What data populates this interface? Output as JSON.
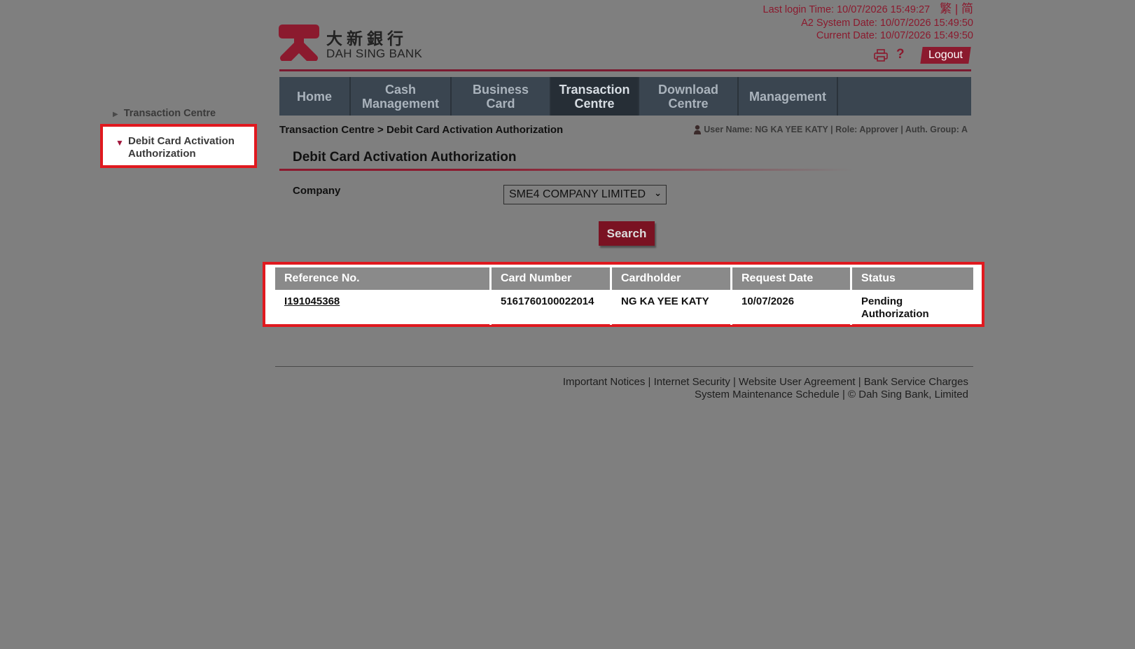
{
  "header": {
    "last_login": "Last login Time: 10/07/2026 15:49:27",
    "lang_links": "繁 | 简",
    "system_date": "A2 System Date: 10/07/2026 15:49:50",
    "current_date": "Current Date: 10/07/2026 15:49:50",
    "help_label": "?",
    "logout_label": "Logout",
    "brand_color": "#8b1a2e"
  },
  "logo": {
    "chinese_name": "大新銀行",
    "english_name": "DAH SING BANK"
  },
  "nav": {
    "items": [
      {
        "label": "Home",
        "active": false
      },
      {
        "label": "Cash Management",
        "active": false
      },
      {
        "label": "Business Card",
        "active": false
      },
      {
        "label": "Transaction Centre",
        "active": true
      },
      {
        "label": "Download Centre",
        "active": false
      },
      {
        "label": "Management",
        "active": false
      }
    ]
  },
  "sidebar": {
    "parent_label": "Transaction Centre",
    "child_label": "Debit Card Activation Authorization"
  },
  "breadcrumb": "Transaction Centre > Debit Card Activation Authorization",
  "user_info": "User Name: NG KA YEE KATY | Role: Approver | Auth. Group: A",
  "page_title": "Debit Card Activation Authorization",
  "form": {
    "company_label": "Company",
    "company_value": "SME4 COMPANY LIMITED",
    "search_label": "Search"
  },
  "table": {
    "headers": [
      "Reference No.",
      "Card Number",
      "Cardholder",
      "Request Date",
      "Status"
    ],
    "rows": [
      [
        "I191045368",
        "5161760100022014",
        "NG KA YEE KATY",
        "10/07/2026",
        "Pending Authorization"
      ]
    ]
  },
  "footer": {
    "line1": "Important Notices | Internet Security | Website User Agreement | Bank Service Charges",
    "line2": "System Maintenance Schedule | © Dah Sing Bank, Limited"
  }
}
